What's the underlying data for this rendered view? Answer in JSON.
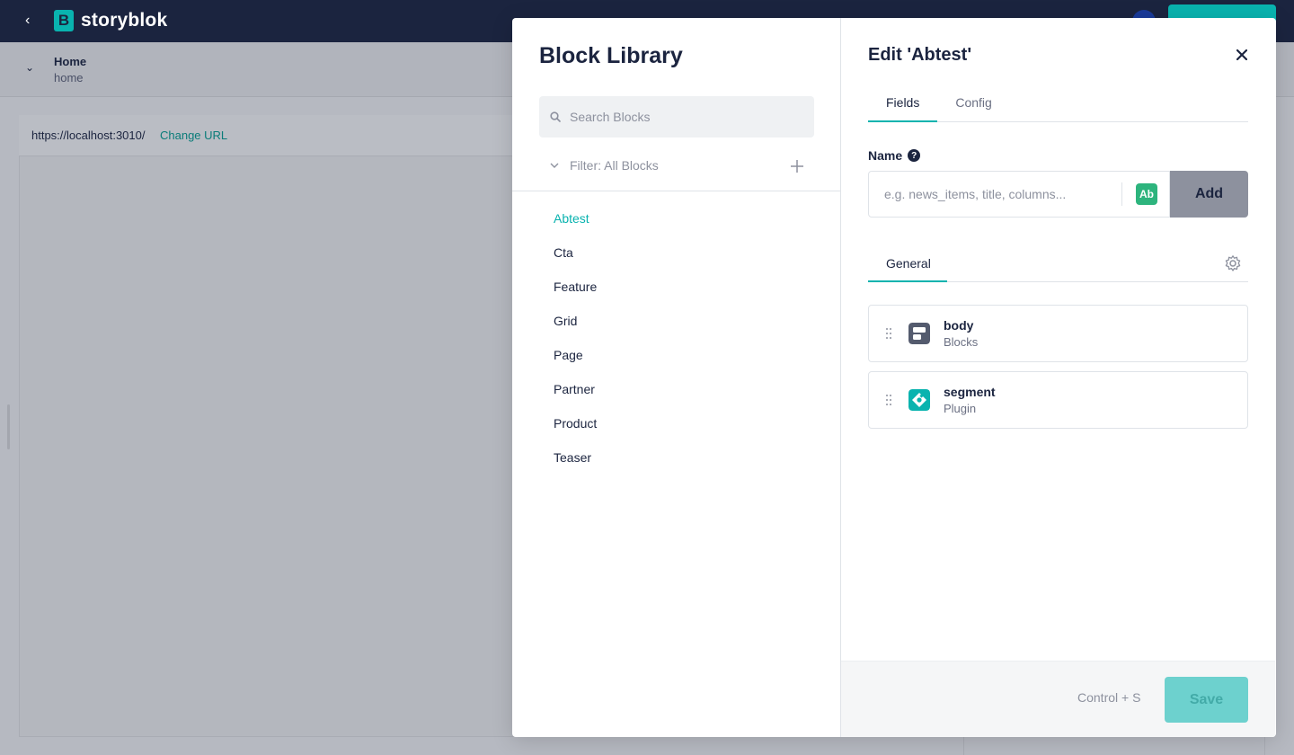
{
  "app": {
    "brand": "storyblok",
    "brand_mark": "B"
  },
  "subheader": {
    "title": "Home",
    "slug": "home"
  },
  "preview": {
    "url": "https://localhost:3010/",
    "change_url_label": "Change URL"
  },
  "library": {
    "title": "Block Library",
    "search_placeholder": "Search Blocks",
    "filter_label": "Filter: All Blocks",
    "blocks": [
      "Abtest",
      "Cta",
      "Feature",
      "Grid",
      "Page",
      "Partner",
      "Product",
      "Teaser"
    ],
    "active_block": "Abtest"
  },
  "editor": {
    "title": "Edit 'Abtest'",
    "tabs": [
      "Fields",
      "Config"
    ],
    "active_tab": "Fields",
    "name_label": "Name",
    "name_placeholder": "e.g. news_items, title, columns...",
    "ab_label": "Ab",
    "add_label": "Add",
    "group_tab": "General",
    "fields": [
      {
        "name": "body",
        "type": "Blocks",
        "icon": "blocks-icon"
      },
      {
        "name": "segment",
        "type": "Plugin",
        "icon": "plugin-icon"
      }
    ],
    "shortcut": "Control + S",
    "save_label": "Save"
  },
  "colors": {
    "accent": "#09b3af",
    "navy": "#1b243f"
  }
}
